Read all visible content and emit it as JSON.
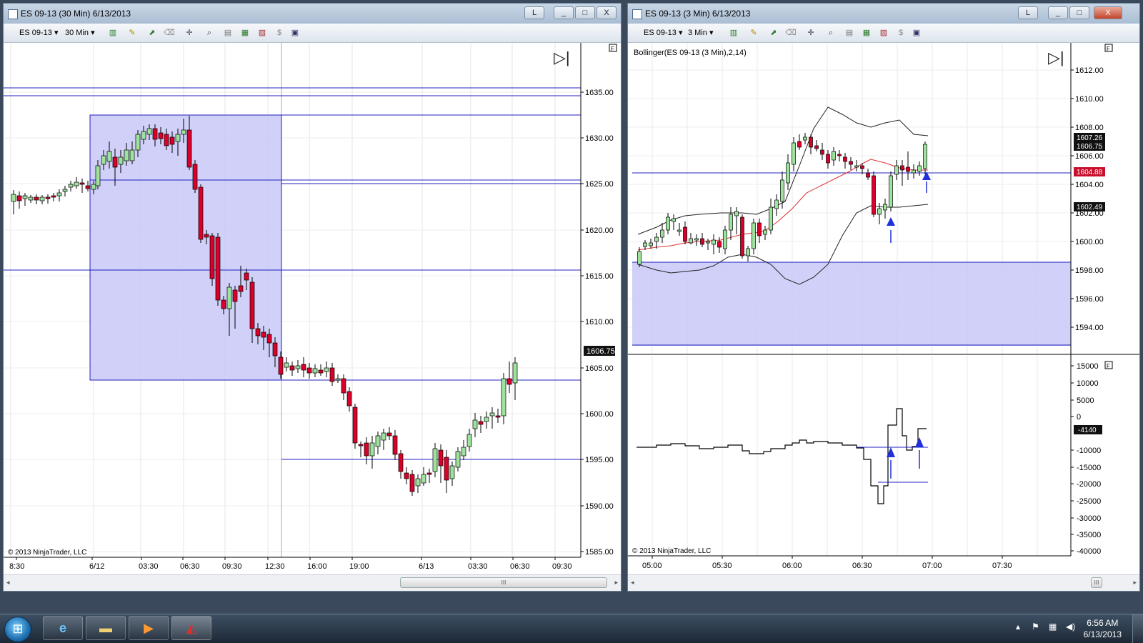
{
  "left_window": {
    "title": "ES 09-13 (30 Min)  6/13/2013",
    "toolbar": {
      "instrument": "ES 09-13",
      "interval": "30 Min"
    },
    "price_axis": [
      "1635.00",
      "1630.00",
      "1625.00",
      "1620.00",
      "1615.00",
      "1610.00",
      "1605.00",
      "1600.00",
      "1595.00",
      "1590.00",
      "1585.00"
    ],
    "time_axis": [
      "8:30",
      "6/12",
      "03:30",
      "06:30",
      "09:30",
      "12:30",
      "16:00",
      "19:00",
      "6/13",
      "03:30",
      "06:30",
      "09:30"
    ],
    "last_price": "1606.75",
    "copyright": "© 2013 NinjaTrader, LLC",
    "scroll_label": "III"
  },
  "right_window": {
    "title": "ES 09-13 (3 Min)  6/13/2013",
    "toolbar": {
      "instrument": "ES 09-13",
      "interval": "3 Min"
    },
    "indicator_label": "Bollinger(ES 09-13 (3 Min),2,14)",
    "price_axis": [
      "1612.00",
      "1610.00",
      "1608.00",
      "1606.00",
      "1604.00",
      "1602.00",
      "1600.00",
      "1598.00",
      "1596.00",
      "1594.00"
    ],
    "price_tags": [
      "1607.26",
      "1606.75",
      "1604.88",
      "1602.49"
    ],
    "lower_axis": [
      "15000",
      "10000",
      "5000",
      "0",
      "-10000",
      "-15000",
      "-20000",
      "-25000",
      "-30000",
      "-35000",
      "-40000"
    ],
    "lower_tag": "-4140",
    "time_axis": [
      "05:00",
      "05:30",
      "06:00",
      "06:30",
      "07:00",
      "07:30"
    ],
    "copyright": "© 2013 NinjaTrader, LLC",
    "scroll_label": "III"
  },
  "window_buttons": {
    "link": "L",
    "minimize": "_",
    "maximize": "□",
    "close": "X"
  },
  "panel_buttons": {
    "f_label": "F",
    "goto_end": "▷|"
  },
  "colors": {
    "up": "#9ee29e",
    "down": "#d9002a",
    "zone": "#c8c8f8",
    "hline": "#2020c0",
    "sma": "#e03030",
    "arrow": "#1f2fd9"
  },
  "taskbar": {
    "time": "6:56 AM",
    "date": "6/13/2013"
  }
}
